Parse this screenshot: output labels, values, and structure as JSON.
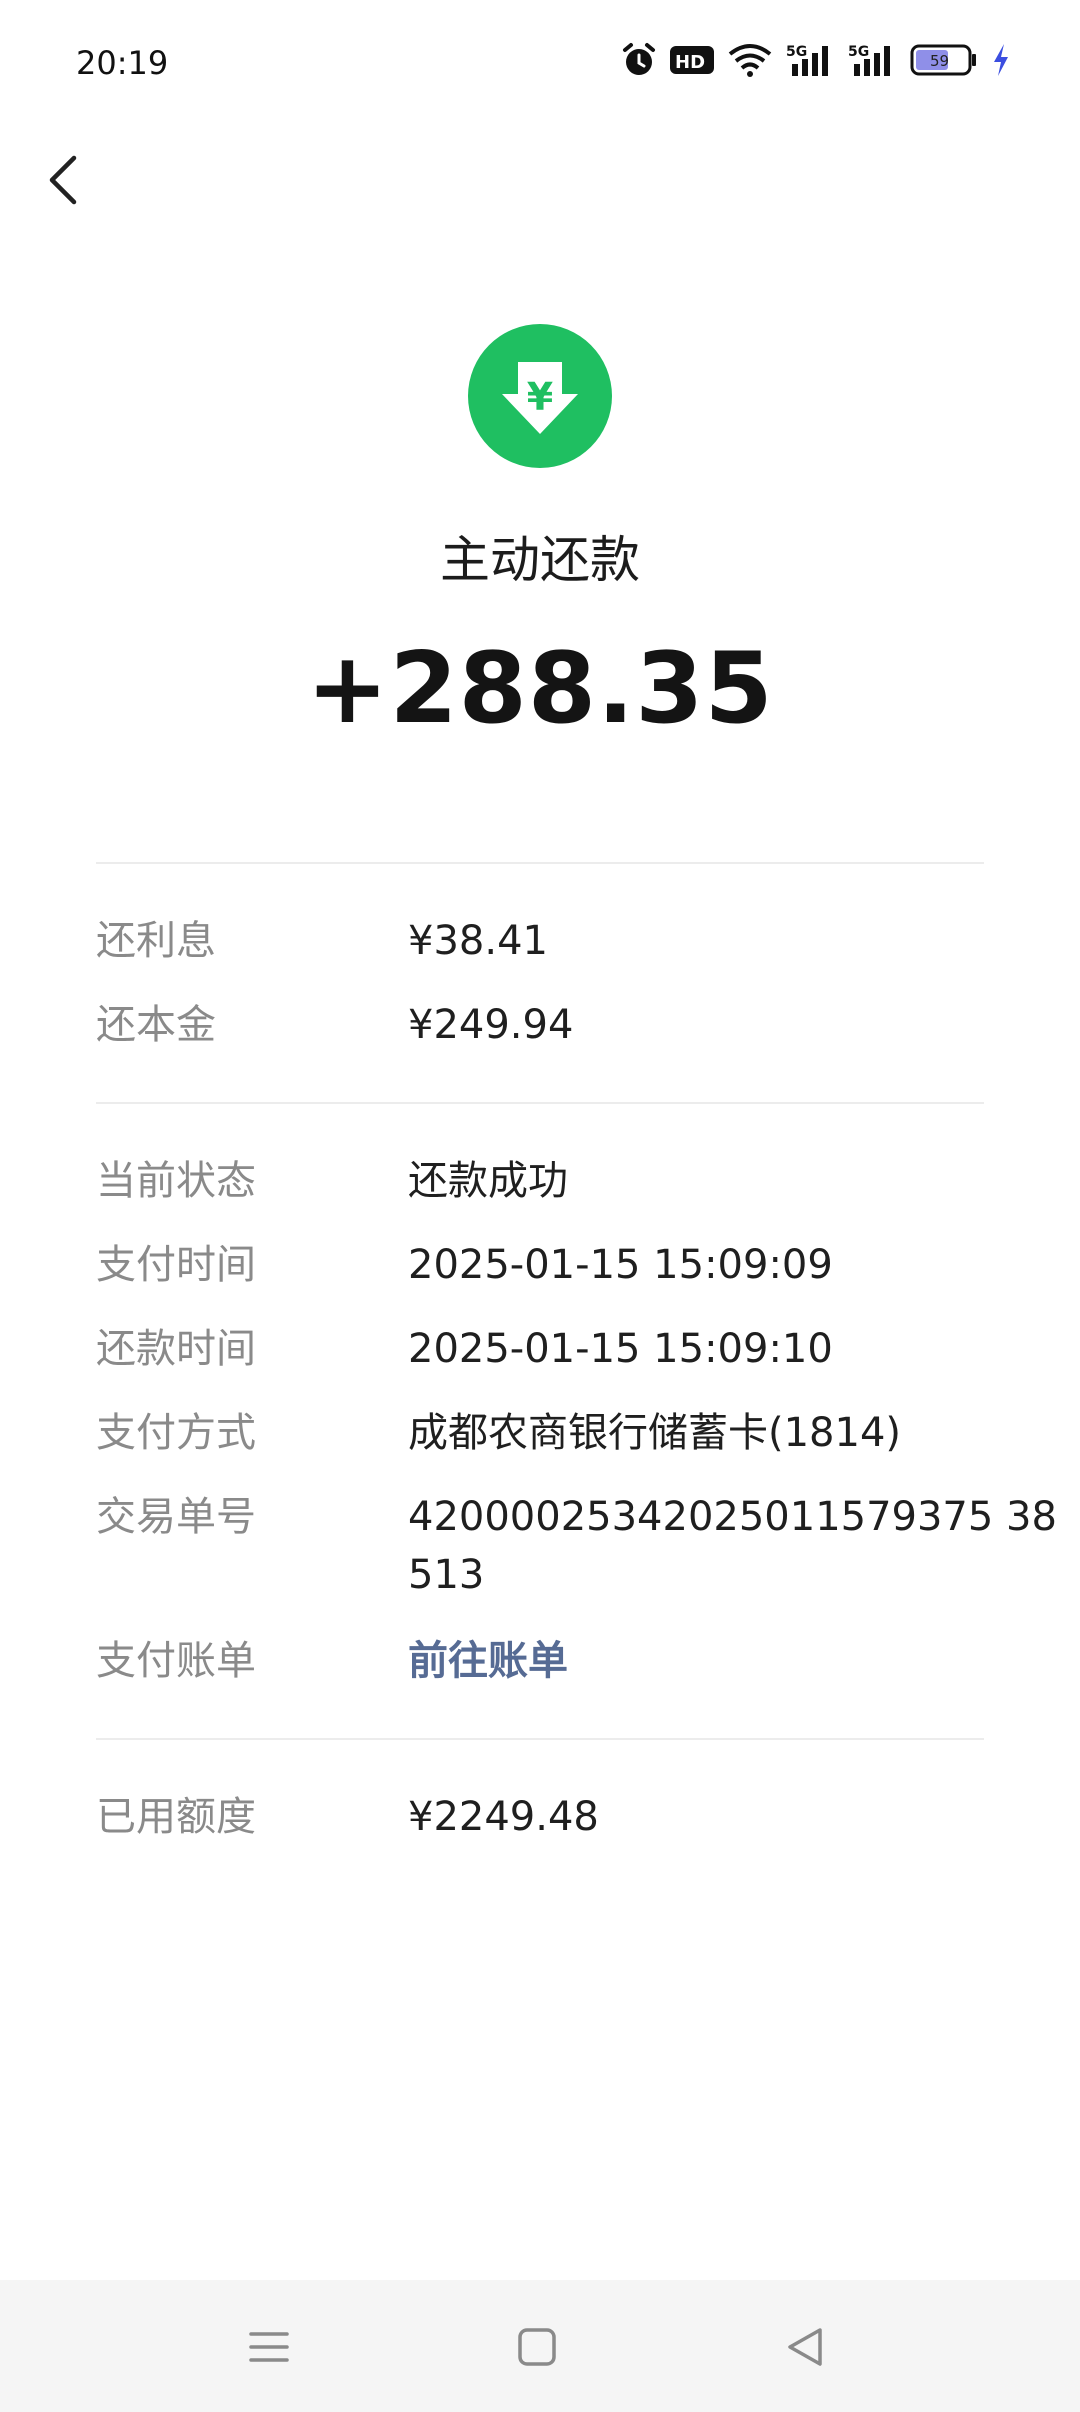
{
  "status_bar": {
    "time": "20:19",
    "hd_label": "HD",
    "signal1_label": "5G",
    "signal2_label": "5G",
    "battery_level": "59",
    "icons": [
      "alarm-icon",
      "hd-icon",
      "wifi-icon",
      "signal-5g-icon",
      "signal-5g-icon",
      "battery-icon",
      "charging-icon"
    ]
  },
  "header": {
    "back_icon": "chevron-left-icon"
  },
  "hero": {
    "icon": "yuan-down-arrow-icon",
    "icon_glyph": "¥",
    "icon_color": "#1fbf61",
    "title": "主动还款",
    "amount": "+288.35"
  },
  "breakdown": [
    {
      "label": "还利息",
      "value": "¥38.41"
    },
    {
      "label": "还本金",
      "value": "¥249.94"
    }
  ],
  "details": [
    {
      "label": "当前状态",
      "value": "还款成功"
    },
    {
      "label": "支付时间",
      "value": "2025-01-15 15:09:09"
    },
    {
      "label": "还款时间",
      "value": "2025-01-15 15:09:10"
    },
    {
      "label": "支付方式",
      "value": "成都农商银行储蓄卡(1814)"
    },
    {
      "label": "交易单号",
      "value": "42000025342025011579375 38513"
    },
    {
      "label": "支付账单",
      "value": "前往账单"
    }
  ],
  "credit": {
    "label": "已用额度",
    "value": "¥2249.48"
  },
  "colors": {
    "link": "#566b94",
    "label": "#8a8a8a",
    "accent_green": "#1fbf61"
  },
  "nav": {
    "items": [
      "menu-icon",
      "home-icon",
      "back-triangle-icon"
    ]
  }
}
